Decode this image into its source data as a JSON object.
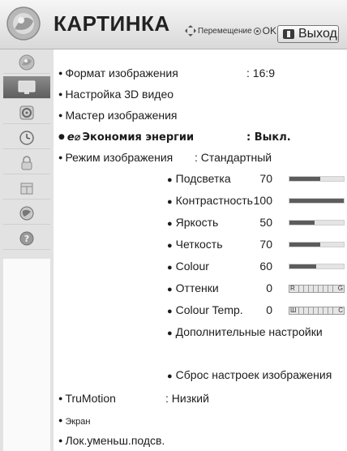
{
  "header": {
    "title": "КАРТИНКА",
    "hint_move": "Перемещение",
    "hint_ok": "OK",
    "exit_label": "Выход",
    "icon": "picture-menu-icon"
  },
  "sidebar": {
    "items": [
      {
        "icon": "picture-settings-icon"
      },
      {
        "icon": "picture-tv-icon",
        "active": true
      },
      {
        "icon": "audio-speaker-icon"
      },
      {
        "icon": "clock-icon"
      },
      {
        "icon": "lock-icon"
      },
      {
        "icon": "option-box-icon"
      },
      {
        "icon": "network-globe-icon"
      },
      {
        "icon": "help-question-icon"
      }
    ]
  },
  "menu": {
    "aspect_label": "Формат изображения",
    "aspect_value": ": 16:9",
    "setup3d_label": "Настройка 3D видео",
    "wizard_label": "Мастер изображения",
    "eco_icon": "e⌀",
    "eco_label": "Экономия энергии",
    "eco_value": ": Выкл.",
    "mode_label": "Режим изображения",
    "mode_value": ": Стандартный",
    "trumotion_label": "TruMotion",
    "trumotion_value": ": Низкий",
    "screen_label": "Экран",
    "local_dimming_label": "Лок.уменьш.подсв."
  },
  "sub_settings": [
    {
      "label": "Подсветка",
      "value": "70",
      "level": 0.57
    },
    {
      "label": "Контрастность",
      "value": "100",
      "level": 1.0
    },
    {
      "label": "Яркость",
      "value": "50",
      "level": 0.47
    },
    {
      "label": "Четкость",
      "value": "70",
      "level": 0.57
    },
    {
      "label": "Colour",
      "value": "60",
      "level": 0.49
    }
  ],
  "tint": {
    "label": "Оттенки",
    "value": "0",
    "left": "R",
    "right": "G"
  },
  "colour_temp": {
    "label": "Colour Temp.",
    "value": "0",
    "left": "Ш",
    "right": "C"
  },
  "advanced_label": "Дополнительные настройки",
  "reset_label": "Сброс настроек изображения",
  "colors": {
    "accent": "#5c5c5c",
    "active_tab": "#6e6e6e",
    "sidebar_bg": "#e2e2e2"
  }
}
